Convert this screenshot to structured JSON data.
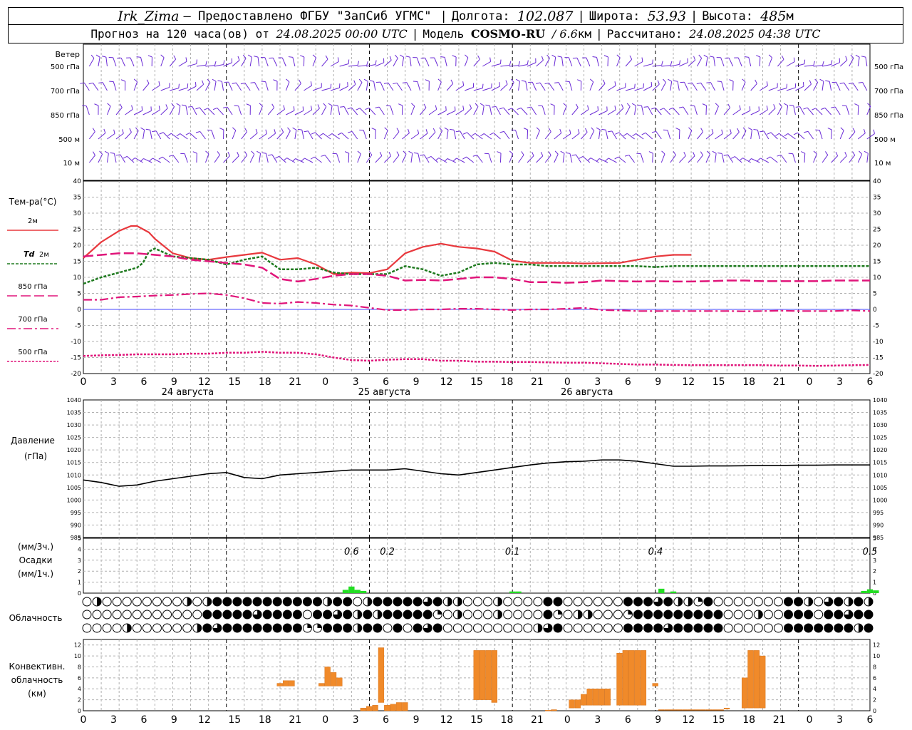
{
  "header": {
    "station": "Irk_Zima",
    "provider": "– Предоставлено ФГБУ \"ЗапСиб УГМС\"",
    "lon_label": "Долгота:",
    "lon_value": "102.087",
    "lat_label": "Широта:",
    "lat_value": "53.93",
    "alt_label": "Высота:",
    "alt_value": "485",
    "alt_unit": "м",
    "forecast_prefix": "Прогноз на 120 часа(ов) от",
    "forecast_start": "24.08.2025 00:00 UTC",
    "model_label": "Модель",
    "model_name": "COSMO-RU",
    "model_res": "/ 6.6",
    "model_res_unit": "км",
    "calc_label": "Рассчитано:",
    "calc_time": "24.08.2025 04:38 UTC"
  },
  "colors": {
    "t2m": "#e8383d",
    "td2m": "#1f7a1f",
    "t850": "#e0157a",
    "t700": "#e0157a",
    "t500": "#e0157a",
    "pressure": "#000000",
    "precip": "#22dd22",
    "convective": "#f08a2a",
    "wind": "#6a2ad6",
    "zero_line": "#4444ff"
  },
  "wind_panel": {
    "title": "Ветер",
    "levels": [
      "500 гПа",
      "700 гПа",
      "850 гПа",
      "500 м",
      "10 м"
    ]
  },
  "temp_panel": {
    "ylabel": "Тем-ра(°C)",
    "legend": [
      {
        "key": "t2m",
        "label": "2м"
      },
      {
        "key": "td2m",
        "prefix": "Td",
        "label": "2м"
      },
      {
        "key": "t850",
        "label": "850 гПа"
      },
      {
        "key": "t700",
        "label": "700 гПа"
      },
      {
        "key": "t500",
        "label": "500 гПа"
      }
    ],
    "day_labels": [
      "24 августа",
      "25 августа",
      "26 августа"
    ]
  },
  "pressure_panel": {
    "ylabel_1": "Давление",
    "ylabel_2": "(гПа)"
  },
  "precip_panel": {
    "ylabel_1": "(мм/3ч.)",
    "ylabel_2": "Осадки",
    "ylabel_3": "(мм/1ч.)",
    "annotations": [
      {
        "h": 45,
        "text": "0.6"
      },
      {
        "h": 51,
        "text": "0.2"
      },
      {
        "h": 72,
        "text": "0.1"
      },
      {
        "h": 96,
        "text": "0.4"
      },
      {
        "h": 132,
        "text": "0.5"
      }
    ]
  },
  "cloud_panel": {
    "ylabel": "Облачность"
  },
  "conv_panel": {
    "ylabel_1": "Конвективн.",
    "ylabel_2": "облачность",
    "ylabel_3": "(км)"
  },
  "chart_data": {
    "type": "line",
    "x_unit": "hours UTC from 24.08.2025 00:00",
    "x_tick_labels": [
      "0",
      "3",
      "6",
      "9",
      "12",
      "15",
      "18",
      "21",
      "0",
      "3",
      "6",
      "9",
      "12",
      "15",
      "18",
      "21",
      "0",
      "3",
      "6",
      "9",
      "12",
      "15",
      "18",
      "21",
      "0",
      "3",
      "6"
    ],
    "temperature": {
      "ylim": [
        -20,
        40
      ],
      "yticks": [
        -20,
        -15,
        -10,
        -5,
        0,
        5,
        10,
        15,
        20,
        25,
        30,
        35,
        40
      ],
      "series": [
        {
          "key": "t2m",
          "name": "2м",
          "x": [
            0,
            3,
            6,
            8,
            9,
            11,
            12,
            15,
            18,
            21,
            24,
            27,
            30,
            33,
            36,
            39,
            42,
            45,
            48,
            51,
            54,
            57,
            60,
            63,
            66,
            69,
            72,
            75,
            78,
            81,
            84,
            87,
            90,
            93,
            96,
            99,
            102,
            105,
            108,
            111,
            114,
            117,
            120,
            123,
            126,
            129,
            132
          ],
          "y": [
            16,
            21,
            24.5,
            26,
            26,
            24,
            22,
            17.5,
            16,
            15.5,
            16.3,
            17,
            17.7,
            15.5,
            16,
            14,
            11,
            11.5,
            11.3,
            12.5,
            17.5,
            19.5,
            20.5,
            19.5,
            19,
            18,
            15.2,
            14.5,
            14.5,
            14.5,
            14.3,
            14.4,
            14.5,
            15.5,
            16.5,
            17,
            17
          ]
        },
        {
          "key": "td2m",
          "name": "Td 2м",
          "x": [
            0,
            3,
            6,
            9,
            10,
            11,
            12,
            15,
            18,
            21,
            24,
            27,
            30,
            33,
            36,
            39,
            42,
            45,
            48,
            51,
            54,
            57,
            60,
            63,
            66,
            69,
            72,
            75,
            78,
            81,
            84,
            87,
            90,
            93,
            96,
            99,
            102,
            105,
            108,
            111,
            114,
            117,
            120,
            123,
            126,
            129,
            132
          ],
          "y": [
            8,
            10,
            11.5,
            13,
            14.5,
            18,
            19,
            16.5,
            16,
            15.5,
            14,
            15.5,
            16.5,
            12.5,
            12.5,
            13,
            11.5,
            11,
            11,
            11,
            13.5,
            12.5,
            10.5,
            11.5,
            14,
            14.5,
            14,
            14,
            13.5,
            13.5,
            13.5,
            13.5,
            13.5,
            13.5,
            13.2,
            13.5,
            13.5,
            13.5,
            13.5,
            13.5,
            13.5,
            13.5,
            13.5,
            13.5,
            13.5,
            13.5,
            13.5
          ]
        },
        {
          "key": "t850",
          "name": "850 гПа",
          "x": [
            0,
            3,
            6,
            9,
            12,
            15,
            18,
            21,
            24,
            27,
            30,
            33,
            36,
            39,
            42,
            45,
            48,
            51,
            54,
            57,
            60,
            63,
            66,
            69,
            72,
            75,
            78,
            81,
            84,
            87,
            90,
            93,
            96,
            99,
            102,
            105,
            108,
            111,
            114,
            117,
            120,
            123,
            126,
            129,
            132
          ],
          "y": [
            16.5,
            17,
            17.5,
            17.5,
            17,
            16.5,
            15.5,
            15,
            14.5,
            14,
            13,
            9.5,
            8.7,
            9.5,
            10.5,
            11,
            11,
            10.5,
            9,
            9.2,
            9,
            9.5,
            10,
            10,
            9.5,
            8.5,
            8.5,
            8.3,
            8.5,
            9,
            8.8,
            8.7,
            8.8,
            8.7,
            8.7,
            8.8,
            9,
            9,
            8.8,
            8.8,
            8.8,
            8.8,
            9,
            9,
            9
          ]
        },
        {
          "key": "t700",
          "name": "700 гПа",
          "x": [
            0,
            3,
            6,
            9,
            12,
            15,
            18,
            21,
            24,
            27,
            30,
            33,
            36,
            39,
            42,
            45,
            48,
            51,
            54,
            57,
            60,
            63,
            66,
            69,
            72,
            75,
            78,
            81,
            84,
            87,
            90,
            93,
            96,
            99,
            102,
            105,
            108,
            111,
            114,
            117,
            120,
            123,
            126,
            129,
            132
          ],
          "y": [
            3,
            3,
            3.8,
            4,
            4.3,
            4.5,
            4.8,
            5,
            4.5,
            3.5,
            2,
            1.8,
            2.3,
            2,
            1.5,
            1.2,
            0.5,
            -0.2,
            -0.2,
            0,
            0,
            0.2,
            0.2,
            0,
            -0.2,
            0,
            0,
            0.2,
            0.5,
            -0.2,
            -0.3,
            -0.5,
            -0.5,
            -0.5,
            -0.5,
            -0.5,
            -0.5,
            -0.6,
            -0.5,
            -0.4,
            -0.5,
            -0.5,
            -0.5,
            -0.3,
            -0.5
          ]
        },
        {
          "key": "t500",
          "name": "500 гПа",
          "x": [
            0,
            3,
            6,
            9,
            12,
            15,
            18,
            21,
            24,
            27,
            30,
            33,
            36,
            39,
            42,
            45,
            48,
            51,
            54,
            57,
            60,
            63,
            66,
            69,
            72,
            75,
            78,
            81,
            84,
            87,
            90,
            93,
            96,
            99,
            102,
            105,
            108,
            111,
            114,
            117,
            120,
            123,
            126,
            129,
            132
          ],
          "y": [
            -14.5,
            -14.3,
            -14.2,
            -14,
            -14,
            -14,
            -13.8,
            -13.8,
            -13.5,
            -13.5,
            -13.2,
            -13.5,
            -13.5,
            -14,
            -15,
            -15.8,
            -16,
            -15.7,
            -15.5,
            -15.5,
            -16,
            -16,
            -16.3,
            -16.3,
            -16.4,
            -16.4,
            -16.5,
            -16.6,
            -16.6,
            -16.8,
            -17,
            -17.2,
            -17.2,
            -17.3,
            -17.4,
            -17.4,
            -17.4,
            -17.4,
            -17.4,
            -17.5,
            -17.5,
            -17.6,
            -17.5,
            -17.4,
            -17.3
          ]
        }
      ]
    },
    "pressure": {
      "ylim": [
        985,
        1040
      ],
      "yticks": [
        985,
        990,
        995,
        1000,
        1005,
        1010,
        1015,
        1020,
        1025,
        1030,
        1035,
        1040
      ],
      "x": [
        0,
        3,
        6,
        9,
        12,
        15,
        18,
        21,
        24,
        27,
        30,
        33,
        36,
        39,
        42,
        45,
        48,
        51,
        54,
        57,
        60,
        63,
        66,
        69,
        72,
        75,
        78,
        81,
        84,
        87,
        90,
        93,
        96,
        99,
        102,
        105,
        108,
        111,
        114,
        117,
        120,
        123,
        126,
        129,
        132
      ],
      "y": [
        1008,
        1007,
        1005.5,
        1006,
        1007.5,
        1008.5,
        1009.5,
        1010.5,
        1011,
        1009,
        1008.5,
        1010,
        1010.5,
        1011,
        1011.5,
        1012,
        1012,
        1012,
        1012.5,
        1011.5,
        1010.5,
        1010,
        1011,
        1012,
        1013,
        1014,
        1014.8,
        1015.3,
        1015.5,
        1016,
        1016,
        1015.5,
        1014.5,
        1013.5,
        1013.5,
        1013.6,
        1013.6,
        1013.7,
        1013.8,
        1013.8,
        1013.9,
        1013.9,
        1014,
        1014,
        1014
      ]
    },
    "precipitation": {
      "ylim": [
        0,
        5
      ],
      "yticks": [
        0,
        1,
        2,
        3,
        4,
        5
      ],
      "bars": [
        {
          "h": 44,
          "v": 0.3
        },
        {
          "h": 45,
          "v": 0.6
        },
        {
          "h": 46,
          "v": 0.3
        },
        {
          "h": 47,
          "v": 0.2
        },
        {
          "h": 72,
          "v": 0.15
        },
        {
          "h": 73,
          "v": 0.15
        },
        {
          "h": 97,
          "v": 0.4
        },
        {
          "h": 99,
          "v": 0.15
        },
        {
          "h": 131,
          "v": 0.2
        },
        {
          "h": 132,
          "v": 0.35
        },
        {
          "h": 133,
          "v": 0.25
        }
      ]
    },
    "convective_cloud": {
      "ylim": [
        0,
        13
      ],
      "yticks": [
        0,
        2,
        4,
        6,
        8,
        10,
        12
      ],
      "bars": [
        {
          "h": 33,
          "base": 4.5,
          "top": 5.0
        },
        {
          "h": 34,
          "base": 4.5,
          "top": 5.5
        },
        {
          "h": 35,
          "base": 4.5,
          "top": 5.5
        },
        {
          "h": 40,
          "base": 4.5,
          "top": 5.0
        },
        {
          "h": 41,
          "base": 4.5,
          "top": 8.0
        },
        {
          "h": 42,
          "base": 4.5,
          "top": 7.0
        },
        {
          "h": 43,
          "base": 4.5,
          "top": 6.0
        },
        {
          "h": 47,
          "base": 0.0,
          "top": 0.5
        },
        {
          "h": 48,
          "base": 0.0,
          "top": 0.8
        },
        {
          "h": 49,
          "base": 0.0,
          "top": 1.0
        },
        {
          "h": 50,
          "base": 1.5,
          "top": 11.5
        },
        {
          "h": 51,
          "base": 0.0,
          "top": 1.0
        },
        {
          "h": 52,
          "base": 0.0,
          "top": 1.2
        },
        {
          "h": 53,
          "base": 0.0,
          "top": 1.5
        },
        {
          "h": 54,
          "base": 0.0,
          "top": 1.5
        },
        {
          "h": 66,
          "base": 2.0,
          "top": 11.0
        },
        {
          "h": 67,
          "base": 2.0,
          "top": 11.0
        },
        {
          "h": 68,
          "base": 2.0,
          "top": 11.0
        },
        {
          "h": 69,
          "base": 1.5,
          "top": 11.0
        },
        {
          "h": 78,
          "base": 0.0,
          "top": 0.1
        },
        {
          "h": 79,
          "base": 0.0,
          "top": 0.2
        },
        {
          "h": 82,
          "base": 0.5,
          "top": 2.0
        },
        {
          "h": 83,
          "base": 0.5,
          "top": 2.0
        },
        {
          "h": 84,
          "base": 1.0,
          "top": 3.0
        },
        {
          "h": 85,
          "base": 1.0,
          "top": 4.0
        },
        {
          "h": 86,
          "base": 1.0,
          "top": 4.0
        },
        {
          "h": 87,
          "base": 1.0,
          "top": 4.0
        },
        {
          "h": 88,
          "base": 1.0,
          "top": 4.0
        },
        {
          "h": 90,
          "base": 1.0,
          "top": 10.5
        },
        {
          "h": 91,
          "base": 1.0,
          "top": 11.0
        },
        {
          "h": 92,
          "base": 1.0,
          "top": 11.0
        },
        {
          "h": 93,
          "base": 1.0,
          "top": 11.0
        },
        {
          "h": 94,
          "base": 1.0,
          "top": 11.0
        },
        {
          "h": 96,
          "base": 4.5,
          "top": 5.0
        },
        {
          "h": 97,
          "base": 0.1,
          "top": 0.2
        },
        {
          "h": 98,
          "base": 0.1,
          "top": 0.2
        },
        {
          "h": 99,
          "base": 0.1,
          "top": 0.2
        },
        {
          "h": 100,
          "base": 0.1,
          "top": 0.2
        },
        {
          "h": 101,
          "base": 0.1,
          "top": 0.2
        },
        {
          "h": 102,
          "base": 0.1,
          "top": 0.2
        },
        {
          "h": 103,
          "base": 0.1,
          "top": 0.2
        },
        {
          "h": 104,
          "base": 0.1,
          "top": 0.2
        },
        {
          "h": 105,
          "base": 0.1,
          "top": 0.2
        },
        {
          "h": 106,
          "base": 0.1,
          "top": 0.2
        },
        {
          "h": 107,
          "base": 0.1,
          "top": 0.2
        },
        {
          "h": 108,
          "base": 0.3,
          "top": 0.5
        },
        {
          "h": 111,
          "base": 0.5,
          "top": 6.0
        },
        {
          "h": 112,
          "base": 0.5,
          "top": 11.0
        },
        {
          "h": 113,
          "base": 0.5,
          "top": 11.0
        },
        {
          "h": 114,
          "base": 0.5,
          "top": 10.0
        }
      ]
    }
  }
}
